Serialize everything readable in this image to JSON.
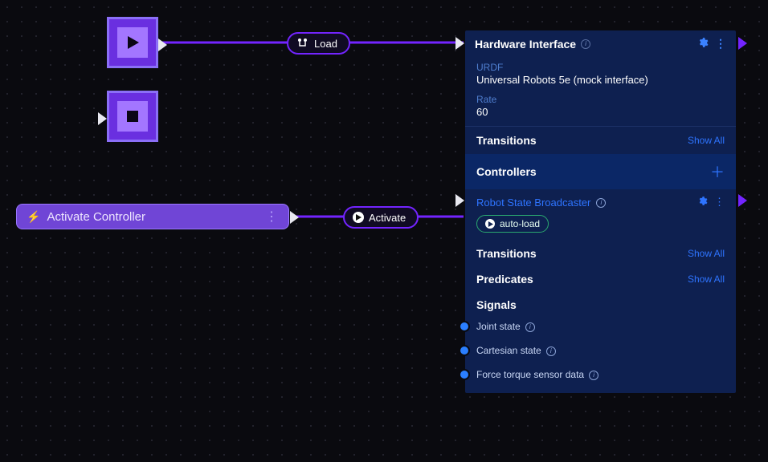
{
  "edges": {
    "load": {
      "label": "Load"
    },
    "activate": {
      "label": "Activate"
    }
  },
  "nodes": {
    "activate_controller": {
      "title": "Activate Controller"
    }
  },
  "panel": {
    "header": {
      "title": "Hardware Interface"
    },
    "fields": {
      "urdf": {
        "label": "URDF",
        "value": "Universal Robots 5e (mock interface)"
      },
      "rate": {
        "label": "Rate",
        "value": "60"
      }
    },
    "transitions": {
      "title": "Transitions",
      "action": "Show All"
    },
    "controllers": {
      "title": "Controllers"
    },
    "rsb": {
      "title": "Robot State Broadcaster",
      "auto_load": "auto-load",
      "transitions": {
        "title": "Transitions",
        "action": "Show All"
      },
      "predicates": {
        "title": "Predicates",
        "action": "Show All"
      },
      "signals_title": "Signals",
      "signals": [
        {
          "label": "Joint state"
        },
        {
          "label": "Cartesian state"
        },
        {
          "label": "Force torque sensor data"
        }
      ]
    }
  }
}
